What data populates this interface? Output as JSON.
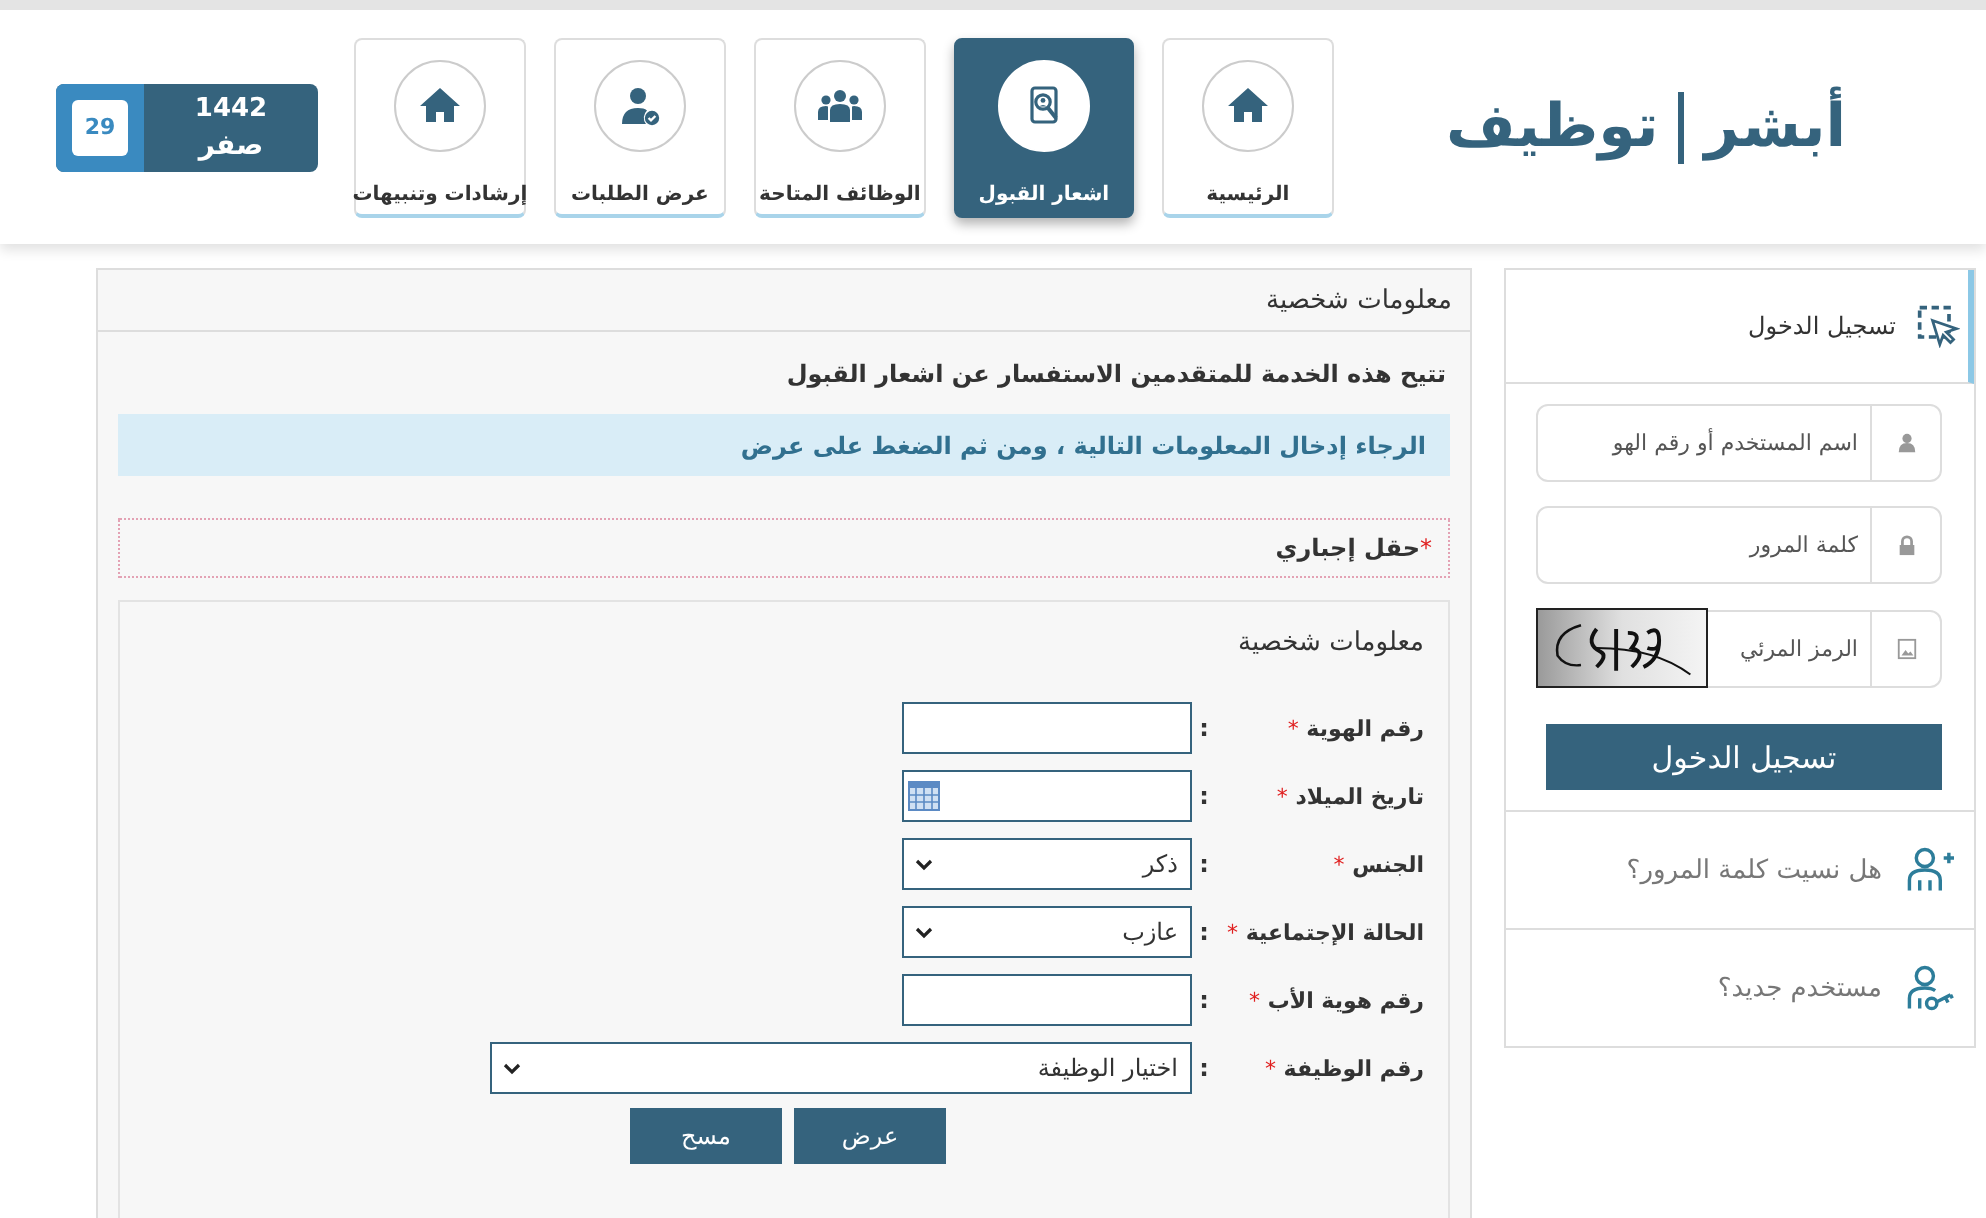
{
  "logo": {
    "part_1": "أبشر",
    "part_2": "توظيف"
  },
  "nav": [
    {
      "label": "الرئيسية",
      "selected": false
    },
    {
      "label": "اشعار القبول",
      "selected": true
    },
    {
      "label": "الوظائف المتاحة",
      "selected": false
    },
    {
      "label": "عرض الطلبات",
      "selected": false
    },
    {
      "label": "إرشادات وتنبيهات",
      "selected": false
    }
  ],
  "date": {
    "day": "29",
    "year": "1442",
    "month": "صفر"
  },
  "sidebar": {
    "login_header": "تسجيل الدخول",
    "fields": [
      {
        "kind": "user",
        "placeholder": "اسم المستخدم أو رقم الهو"
      },
      {
        "kind": "password",
        "placeholder": "كلمة المرور"
      },
      {
        "kind": "captcha",
        "placeholder": "الرمز المرئي"
      }
    ],
    "login_button": "تسجيل الدخول",
    "links": [
      {
        "label": "هل نسيت كلمة المرور؟"
      },
      {
        "label": "مستخدم جديد؟"
      }
    ]
  },
  "panel": {
    "title": "معلومات شخصية",
    "intro": "تتيح هذه الخدمة للمتقدمين الاستفسار عن اشعار القبول",
    "notice": "الرجاء إدخال المعلومات التالية ، ومن ثم الضغط على عرض",
    "required_mark": "*",
    "required_note": "حقل إجباري",
    "form": {
      "title": "معلومات شخصية",
      "fields": [
        {
          "label": "رقم الهوية",
          "mark": "*",
          "colon": ":",
          "kind": "text"
        },
        {
          "label": "تاريخ الميلاد",
          "mark": "*",
          "colon": ":",
          "kind": "date"
        },
        {
          "label": "الجنس",
          "mark": "*",
          "colon": ":",
          "kind": "select",
          "value": "ذكر"
        },
        {
          "label": "الحالة الإجتماعية",
          "mark": "*",
          "colon": ":",
          "kind": "select",
          "value": "عازب"
        },
        {
          "label": "رقم هوية الأب",
          "mark": "*",
          "colon": ":",
          "kind": "text"
        },
        {
          "label": "رقم الوظيفة",
          "mark": "*",
          "colon": ":",
          "kind": "wide-select",
          "value": "اختيار الوظيفة"
        }
      ],
      "buttons": [
        "عرض",
        "مسح"
      ]
    }
  }
}
